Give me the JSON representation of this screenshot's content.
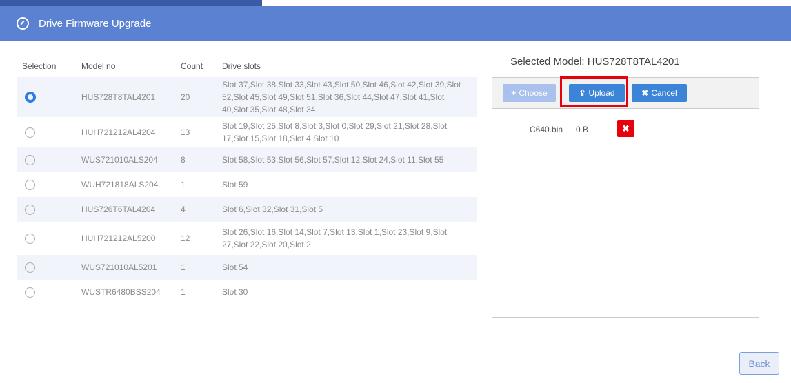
{
  "dialog": {
    "title": "Drive Firmware Upgrade"
  },
  "table": {
    "headers": {
      "selection": "Selection",
      "model": "Model no",
      "count": "Count",
      "slots": "Drive slots"
    },
    "rows": [
      {
        "selected": true,
        "model": "HUS728T8TAL4201",
        "count": "20",
        "slots": "Slot 37,Slot 38,Slot 33,Slot 43,Slot 50,Slot 46,Slot 42,Slot 39,Slot 52,Slot 45,Slot 49,Slot 51,Slot 36,Slot 44,Slot 47,Slot 41,Slot 40,Slot 35,Slot 48,Slot 34"
      },
      {
        "selected": false,
        "model": "HUH721212AL4204",
        "count": "13",
        "slots": "Slot 19,Slot 25,Slot 8,Slot 3,Slot 0,Slot 29,Slot 21,Slot 28,Slot 17,Slot 15,Slot 18,Slot 4,Slot 10"
      },
      {
        "selected": false,
        "model": "WUS721010ALS204",
        "count": "8",
        "slots": "Slot 58,Slot 53,Slot 56,Slot 57,Slot 12,Slot 24,Slot 11,Slot 55"
      },
      {
        "selected": false,
        "model": "WUH721818ALS204",
        "count": "1",
        "slots": "Slot 59"
      },
      {
        "selected": false,
        "model": "HUS726T6TAL4204",
        "count": "4",
        "slots": "Slot 6,Slot 32,Slot 31,Slot 5"
      },
      {
        "selected": false,
        "model": "HUH721212AL5200",
        "count": "12",
        "slots": "Slot 26,Slot 16,Slot 14,Slot 7,Slot 13,Slot 1,Slot 23,Slot 9,Slot 27,Slot 22,Slot 20,Slot 2"
      },
      {
        "selected": false,
        "model": "WUS721010AL5201",
        "count": "1",
        "slots": "Slot 54"
      },
      {
        "selected": false,
        "model": "WUSTR6480BSS204",
        "count": "1",
        "slots": "Slot 30"
      }
    ]
  },
  "selected_model": {
    "label": "Selected Model: HUS728T8TAL4201"
  },
  "upload": {
    "choose_label": "Choose",
    "upload_label": "Upload",
    "cancel_label": "Cancel",
    "file": {
      "name": "C640.bin",
      "size": "0 B"
    }
  },
  "footer": {
    "back_label": "Back"
  },
  "colors": {
    "header": "#5b82d2",
    "accent": "#3c84d8",
    "danger": "#e8000d"
  }
}
